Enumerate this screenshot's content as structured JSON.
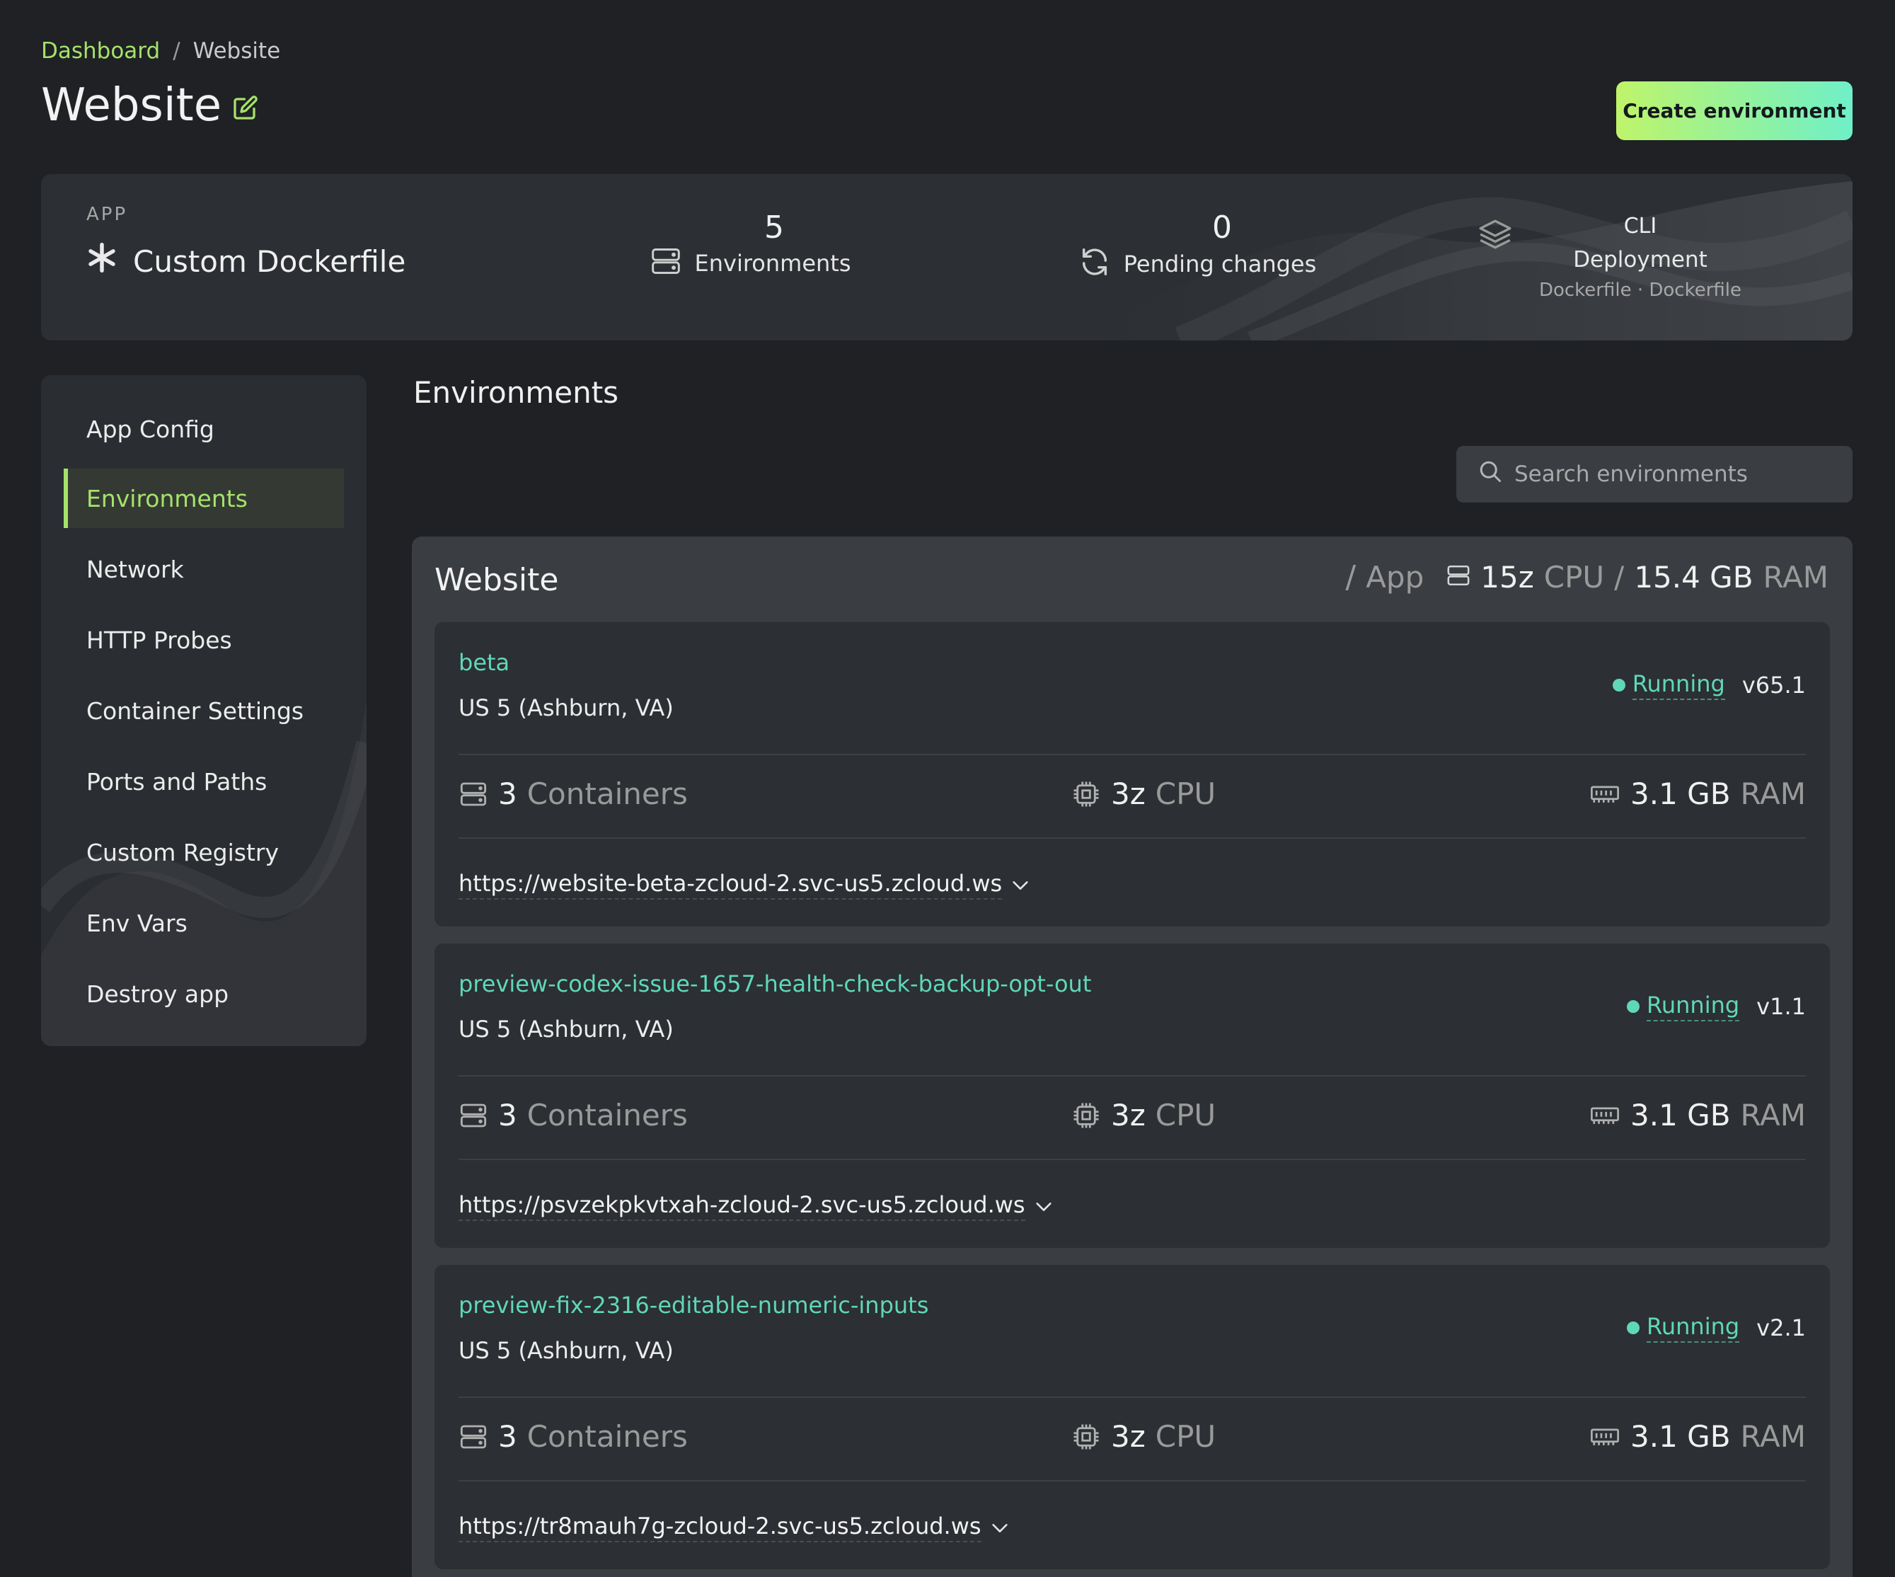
{
  "breadcrumb": {
    "parent": "Dashboard",
    "separator": "/",
    "current": "Website"
  },
  "page": {
    "title": "Website",
    "create_button": "Create environment"
  },
  "banner": {
    "app_label": "APP",
    "app_type": "Custom Dockerfile",
    "environments_count": "5",
    "environments_label": "Environments",
    "pending_count": "0",
    "pending_label": "Pending changes",
    "deploy_top": "CLI",
    "deploy_label": "Deployment",
    "deploy_sub": "Dockerfile · Dockerfile"
  },
  "sidebar": {
    "items": [
      {
        "label": "App Config",
        "active": false
      },
      {
        "label": "Environments",
        "active": true
      },
      {
        "label": "Network",
        "active": false
      },
      {
        "label": "HTTP Probes",
        "active": false
      },
      {
        "label": "Container Settings",
        "active": false
      },
      {
        "label": "Ports and Paths",
        "active": false
      },
      {
        "label": "Custom Registry",
        "active": false
      },
      {
        "label": "Env Vars",
        "active": false
      },
      {
        "label": "Destroy app",
        "active": false
      }
    ]
  },
  "main": {
    "section_title": "Environments",
    "search_placeholder": "Search environments",
    "group": {
      "title": "Website",
      "sep": "/",
      "type": "App",
      "cpu_value": "15z",
      "cpu_unit": "CPU",
      "ram_value": "15.4 GB",
      "ram_unit": "RAM"
    },
    "environments": [
      {
        "name": "beta",
        "region": "US 5 (Ashburn, VA)",
        "status": "Running",
        "version": "v65.1",
        "containers_value": "3",
        "containers_unit": "Containers",
        "cpu_value": "3z",
        "cpu_unit": "CPU",
        "ram_value": "3.1 GB",
        "ram_unit": "RAM",
        "url": "https://website-beta-zcloud-2.svc-us5.zcloud.ws"
      },
      {
        "name": "preview-codex-issue-1657-health-check-backup-opt-out",
        "region": "US 5 (Ashburn, VA)",
        "status": "Running",
        "version": "v1.1",
        "containers_value": "3",
        "containers_unit": "Containers",
        "cpu_value": "3z",
        "cpu_unit": "CPU",
        "ram_value": "3.1 GB",
        "ram_unit": "RAM",
        "url": "https://psvzekpkvtxah-zcloud-2.svc-us5.zcloud.ws"
      },
      {
        "name": "preview-fix-2316-editable-numeric-inputs",
        "region": "US 5 (Ashburn, VA)",
        "status": "Running",
        "version": "v2.1",
        "containers_value": "3",
        "containers_unit": "Containers",
        "cpu_value": "3z",
        "cpu_unit": "CPU",
        "ram_value": "3.1 GB",
        "ram_unit": "RAM",
        "url": "https://tr8mauh7g-zcloud-2.svc-us5.zcloud.ws"
      }
    ]
  },
  "colors": {
    "accent_green": "#a6e26a",
    "teal": "#5fd8b7",
    "background": "#1f2124",
    "card": "#2c2f33"
  }
}
